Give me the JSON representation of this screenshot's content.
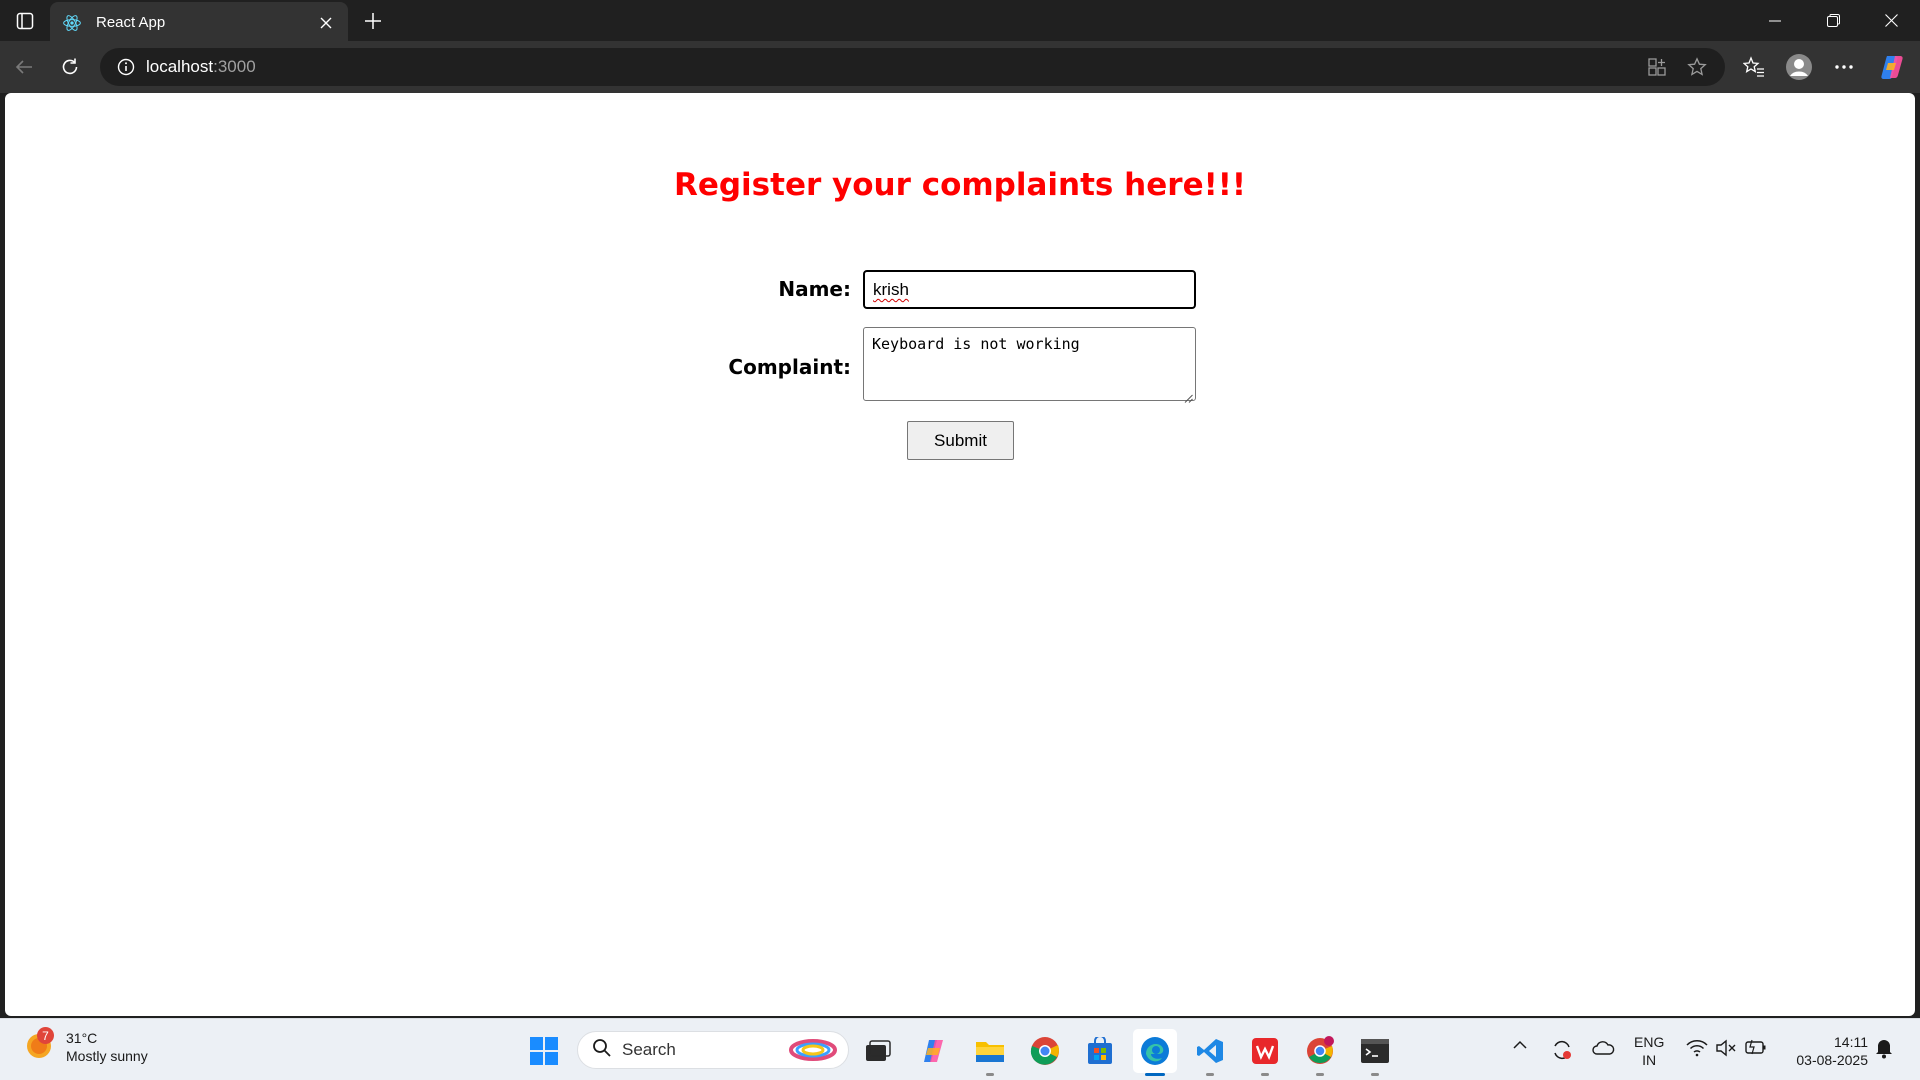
{
  "browser": {
    "tab_title": "React App",
    "url_host": "localhost",
    "url_port": ":3000"
  },
  "page": {
    "heading": "Register your complaints here!!!",
    "name_label": "Name:",
    "name_value": "krish",
    "complaint_label": "Complaint:",
    "complaint_value": "Keyboard is not working",
    "submit_label": "Submit",
    "heading_color": "#ff0000"
  },
  "taskbar": {
    "weather_temp": "31°C",
    "weather_desc": "Mostly sunny",
    "weather_badge": "7",
    "search_label": "Search",
    "lang_line1": "ENG",
    "lang_line2": "IN",
    "time": "14:11",
    "date": "03-08-2025"
  }
}
